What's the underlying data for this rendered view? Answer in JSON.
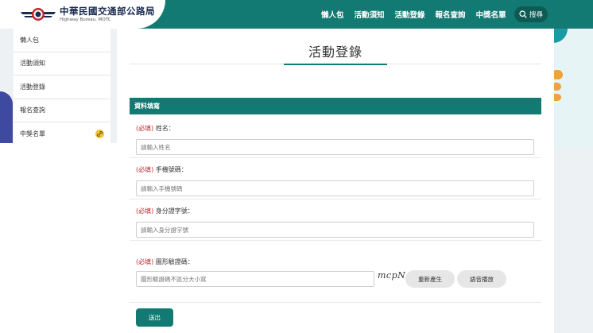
{
  "header": {
    "logo_title": "中華民國交通部公路局",
    "logo_subtitle": "Highway Bureau, MOTC",
    "nav": [
      "懶人包",
      "活動須知",
      "活動登錄",
      "報名查詢",
      "中獎名單"
    ],
    "search_label": "搜尋"
  },
  "sidebar": {
    "items": [
      "懶人包",
      "活動須知",
      "活動登錄",
      "報名查詢",
      "中獎名單"
    ]
  },
  "main": {
    "title": "活動登錄",
    "section_title": "資料填寫",
    "required_tag": "(必填)",
    "fields": {
      "name": {
        "label": "姓名：",
        "placeholder": "請輸入姓名"
      },
      "phone": {
        "label": "手機號碼：",
        "placeholder": "請輸入手機號碼"
      },
      "id_number": {
        "label": "身分證字號：",
        "placeholder": "請輸入身分證字號"
      },
      "captcha": {
        "label": "圖形驗證碼：",
        "placeholder": "圖形驗證碼不區分大小寫",
        "image_text": "mcpN"
      }
    },
    "buttons": {
      "regenerate": "重新產生",
      "audio": "語音播放",
      "submit": "送出"
    }
  },
  "colors": {
    "primary": "#127a72",
    "required": "#c0282d",
    "badge": "#f4c430"
  }
}
